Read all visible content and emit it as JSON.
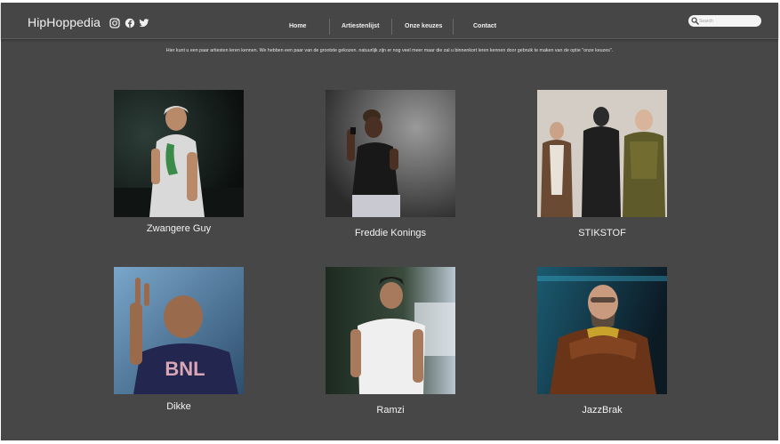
{
  "header": {
    "logo": "HipHoppedia",
    "social": [
      {
        "icon": "instagram-icon"
      },
      {
        "icon": "facebook-icon"
      },
      {
        "icon": "twitter-icon"
      }
    ],
    "nav": [
      {
        "label": "Home"
      },
      {
        "label": "Artiestenlijst"
      },
      {
        "label": "Onze keuzes"
      },
      {
        "label": "Contact"
      }
    ],
    "search": {
      "placeholder": "Search",
      "icon": "search-icon"
    }
  },
  "intro": "Hier kunt u een paar artiesten leren kennen. We hebben een paar van de grootste gekozen. natuurlijk zijn er nog veel meer maar die zal u binnenkort leren kennen door gebruik te maken van de optie \"onze keuzes\".",
  "artists": [
    {
      "name": "Zwangere Guy"
    },
    {
      "name": "Freddie Konings"
    },
    {
      "name": "STIKSTOF"
    },
    {
      "name": "Dikke"
    },
    {
      "name": "Ramzi"
    },
    {
      "name": "JazzBrak"
    }
  ],
  "colors": {
    "background": "#474747",
    "text": "#f2f2f2",
    "search_bg": "#f4f4f4"
  }
}
